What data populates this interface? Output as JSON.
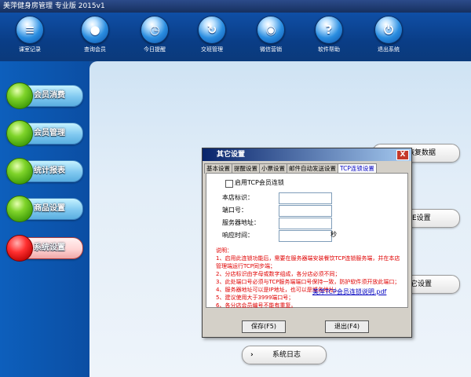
{
  "window": {
    "title": "美萍健身房管理  专业版  2015v1"
  },
  "toolbar": {
    "items": [
      {
        "label": "课室记录",
        "icon": "notebook-icon"
      },
      {
        "label": "查询会员",
        "icon": "user-icon"
      },
      {
        "label": "今日提醒",
        "icon": "clock-icon"
      },
      {
        "label": "交班管理",
        "icon": "refresh-icon"
      },
      {
        "label": "微信营销",
        "icon": "wechat-icon"
      },
      {
        "label": "软件帮助",
        "icon": "help-icon"
      },
      {
        "label": "退出系统",
        "icon": "power-icon"
      }
    ]
  },
  "sidebar": {
    "items": [
      {
        "label": "会员消费"
      },
      {
        "label": "会员管理"
      },
      {
        "label": "统计报表"
      },
      {
        "label": "商品设置"
      },
      {
        "label": "系统设置",
        "active": true
      }
    ]
  },
  "main": {
    "pills": [
      {
        "label": "恢复数据"
      },
      {
        "label": "E设置"
      },
      {
        "label": "它设置"
      },
      {
        "label": "系统日志"
      }
    ]
  },
  "dialog": {
    "title": "其它设置",
    "close": "X",
    "tabs": [
      "基本设置",
      "提醒设置",
      "小票设置",
      "邮件自动发送设置",
      "TCP连锁设置"
    ],
    "active_tab": 4,
    "checkbox_label": "启用TCP会员连锁",
    "checkbox_checked": false,
    "fields": [
      {
        "label": "本店标识：",
        "value": ""
      },
      {
        "label": "端口号：",
        "value": ""
      },
      {
        "label": "服务器地址：",
        "value": ""
      },
      {
        "label": "响应时间：",
        "value": ""
      }
    ],
    "unit": "秒",
    "notes_title": "说明：",
    "notes": [
      "1、启用此连锁功能后，需要在服务器端安装餐饮TCP连锁服务端，并在本店管理端运行TCP同步端；",
      "2、分店标识由字母或数字组成，各分店必须不同；",
      "3、此处端口号必须与TCP服务端端口号保持一致，防护软件须开放此端口；",
      "4、服务器地址可以是IP地址，也可以是域名地址；",
      "5、建议使用大于3999端口号；",
      "6、各分店会员编号不能有重复。"
    ],
    "pdf_link": "美萍TCP会员连锁说明.pdf",
    "save_button": "保存(F5)",
    "exit_button": "退出(F4)"
  }
}
